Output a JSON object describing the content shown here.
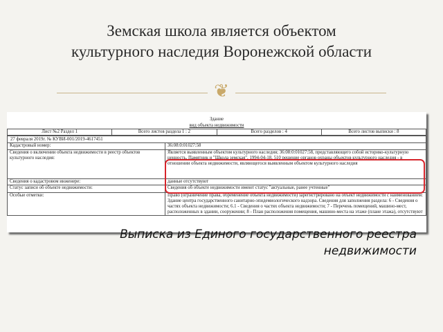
{
  "slide": {
    "title_line1": "Земская школа является объектом",
    "title_line2": "культурного наследия Воронежской области",
    "ornament": "❦",
    "caption_line1": "Выписка из Единого государственного реестра",
    "caption_line2": "недвижимости"
  },
  "document": {
    "heading": "Здание",
    "subheading": "вид объекта недвижимости",
    "grid": [
      "Лист №2  Раздел 1",
      "Всего листов раздела 1 : 2",
      "Всего разделов : 4",
      "Всего листов выписки : 8"
    ],
    "date_line": "27 февраля 2019г. № КУВИ-001/2019-4617451",
    "rows": [
      {
        "label": "Кадастровый номер:",
        "value": "36:08:0:01027:58"
      },
      {
        "label": "Сведения о включении объекта недвижимости в реестр объектов культурного наследия:",
        "value": "Является выявленным объектом культурного наследия; 36:08:0:01027:58, представляющего собой историко-культурную ценность, Памятник и \"Школа земская\", 1994-04-18, 510 решение органов охраны объектов культурного наследия - в отношении объекта недвижимости, являющегося выявленным объектом культурного наследия"
      },
      {
        "label": "Сведения о кадастровом инженере:",
        "value": "данные отсутствуют"
      },
      {
        "label": "Статус записи об объекте недвижимости:",
        "value": "Сведения об объекте недвижимости имеют статус \"актуальные, ранее учтенные\""
      },
      {
        "label": "Особые отметки:",
        "value": "Право (ограничение права, обременение объекта недвижимости) зарегистрировано на объект недвижимости с наименованием: Здание центра государственного санитарно-эпидемиологического надзора. Сведения для заполнения раздела: 6 - Сведения о частях объекта недвижимости; 6.1 - Сведения о частях объекта недвижимости; 7 - Перечень помещений, машино-мест, расположенных в здании, сооружении; 8 - План расположения помещения, машино-места на этаже (плане этажа), отсутствуют"
      }
    ]
  }
}
